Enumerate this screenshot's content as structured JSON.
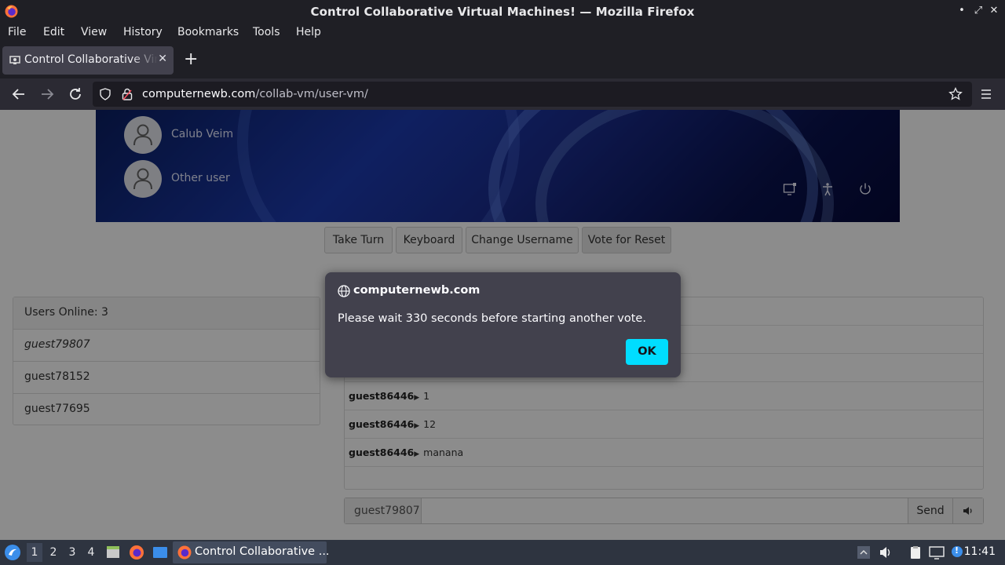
{
  "window": {
    "title": "Control Collaborative Virtual Machines! — Mozilla Firefox",
    "controls": [
      "•",
      "⤢",
      "✕"
    ]
  },
  "menu": [
    "File",
    "Edit",
    "View",
    "History",
    "Bookmarks",
    "Tools",
    "Help"
  ],
  "tab": {
    "label": "Control Collaborative Virtual Machines!",
    "close": "✕",
    "new_tab": "+"
  },
  "navbar": {
    "url_host": "computernewb.com",
    "url_path": "/collab-vm/user-vm/"
  },
  "vm": {
    "users": [
      {
        "name": "Calub Veim"
      },
      {
        "name": "Other user"
      }
    ],
    "icons": [
      "network-icon",
      "accessibility-icon",
      "power-icon"
    ]
  },
  "buttons": {
    "take_turn": "Take Turn",
    "keyboard": "Keyboard",
    "change_username": "Change Username",
    "vote_reset": "Vote for Reset"
  },
  "users_online": {
    "header": "Users Online: 3",
    "list": [
      "guest79807",
      "guest78152",
      "guest77695"
    ]
  },
  "chat": {
    "messages": [
      {
        "user": "guest86446",
        "text": "1"
      },
      {
        "user": "guest86446",
        "text": "12"
      },
      {
        "user": "guest86446",
        "text": "manana"
      }
    ],
    "username": "guest79807",
    "send": "Send",
    "sound_icon": "speaker-icon"
  },
  "dialog": {
    "host": "computernewb.com",
    "message": "Please wait 330 seconds before starting another vote.",
    "ok": "OK"
  },
  "taskbar": {
    "workspaces": [
      "1",
      "2",
      "3",
      "4"
    ],
    "task_label": "Control Collaborative ...",
    "clock": "11:41",
    "tray_badge": "!"
  },
  "colors": {
    "accent": "#00ddff",
    "dialog_bg": "#42414d",
    "chrome_bg": "#1f1f25",
    "taskbar_bg": "#2e3440"
  }
}
